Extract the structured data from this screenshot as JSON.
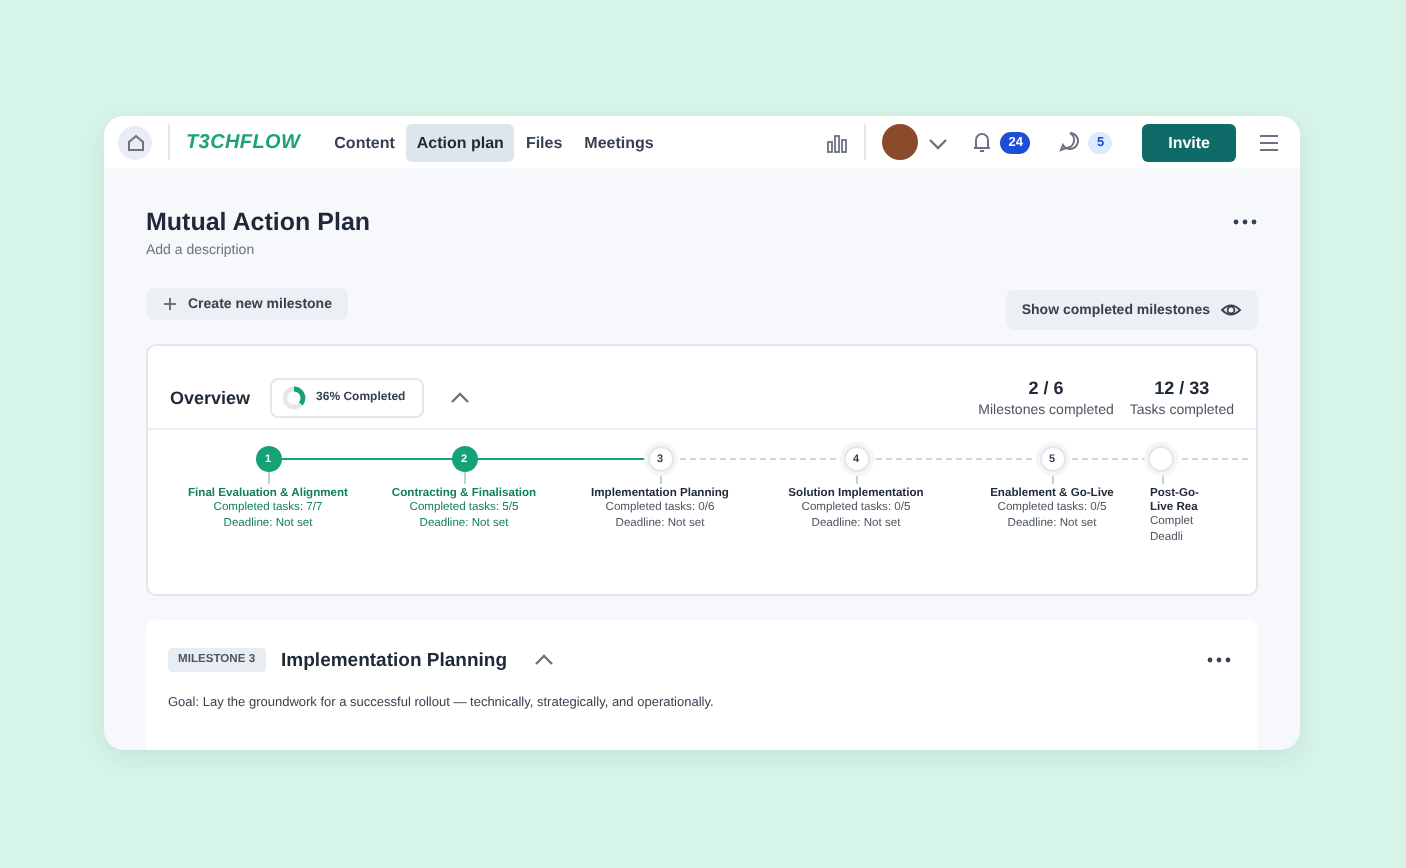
{
  "nav": {
    "logo": "T3CHFLOW",
    "tabs": [
      {
        "label": "Content",
        "selected": false
      },
      {
        "label": "Action plan",
        "selected": true
      },
      {
        "label": "Files",
        "selected": false
      },
      {
        "label": "Meetings",
        "selected": false
      }
    ],
    "notifications": "24",
    "messages": "5",
    "invite": "Invite"
  },
  "plan": {
    "title": "Mutual Action Plan",
    "description": "Add a description",
    "create_button": "Create new milestone",
    "show_completed_button": "Show completed milestones"
  },
  "overview": {
    "title": "Overview",
    "progress_label": "36% Completed",
    "level": 0.36,
    "expanded": true,
    "stats": [
      {
        "value": "2 / 6",
        "label": "Milestones completed"
      },
      {
        "value": "12 / 33",
        "label": "Tasks completed"
      }
    ],
    "milestones": [
      {
        "number": "1",
        "title": "Final Evaluation & Alignment",
        "tasks": "Completed tasks: 7/7",
        "deadline": "Deadline: Not set",
        "completed": true
      },
      {
        "number": "2",
        "title": "Contracting & Finalisation",
        "tasks": "Completed tasks: 5/5",
        "deadline": "Deadline: Not set",
        "completed": true
      },
      {
        "number": "3",
        "title": "Implementation Planning",
        "tasks": "Completed tasks: 0/6",
        "deadline": "Deadline: Not set",
        "completed": false
      },
      {
        "number": "4",
        "title": "Solution Implementation",
        "tasks": "Completed tasks: 0/5",
        "deadline": "Deadline: Not set",
        "completed": false
      },
      {
        "number": "5",
        "title": "Enablement & Go-Live",
        "tasks": "Completed tasks: 0/5",
        "deadline": "Deadline: Not set",
        "completed": false
      },
      {
        "title": "Post-Go-Live Rea",
        "tasks": "Complet",
        "deadline": "Deadli",
        "completed": false
      }
    ]
  },
  "milestone": {
    "tag": "MILESTONE 3",
    "title": "Implementation Planning",
    "expanded": true,
    "goal": "Goal: Lay the groundwork for a successful rollout — technically, strategically, and operationally."
  }
}
